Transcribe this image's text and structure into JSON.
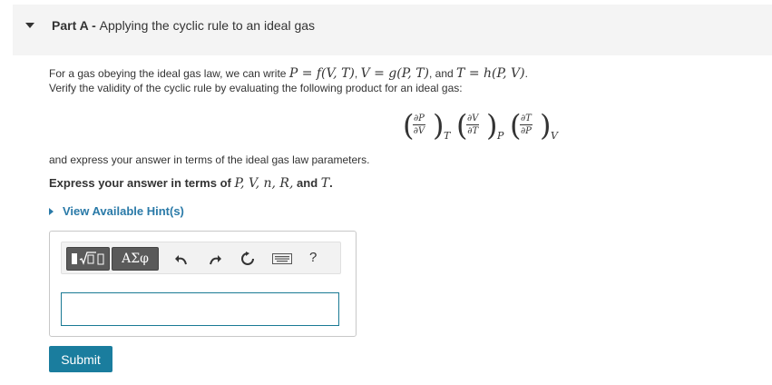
{
  "part": {
    "label": "Part A",
    "separator": " - ",
    "title": "Applying the cyclic rule to an ideal gas"
  },
  "intro": {
    "line1_text": "For a gas obeying the ideal gas law, we can write ",
    "eq1": "P = f(V, T)",
    "eq2": "V = g(P, T)",
    "and_text": ", and ",
    "eq3": "T = h(P, V)",
    "line2": "Verify the validity of the cyclic rule by evaluating the following product for an ideal gas:"
  },
  "formula": {
    "terms": [
      {
        "num": "∂P",
        "den": "∂V",
        "sub": "T"
      },
      {
        "num": "∂V",
        "den": "∂T",
        "sub": "P"
      },
      {
        "num": "∂T",
        "den": "∂P",
        "sub": "V"
      }
    ]
  },
  "after_formula": "and express your answer in terms of the ideal gas law parameters.",
  "instruction": {
    "prefix": "Express your answer in terms of ",
    "vars": "P, V, n, R,",
    "and": " and ",
    "last": "T",
    "suffix": "."
  },
  "hint_label": "View Available Hint(s)",
  "toolbar": {
    "greek_label": "ΑΣφ",
    "help_label": "?"
  },
  "input": {
    "value": ""
  },
  "submit_label": "Submit"
}
